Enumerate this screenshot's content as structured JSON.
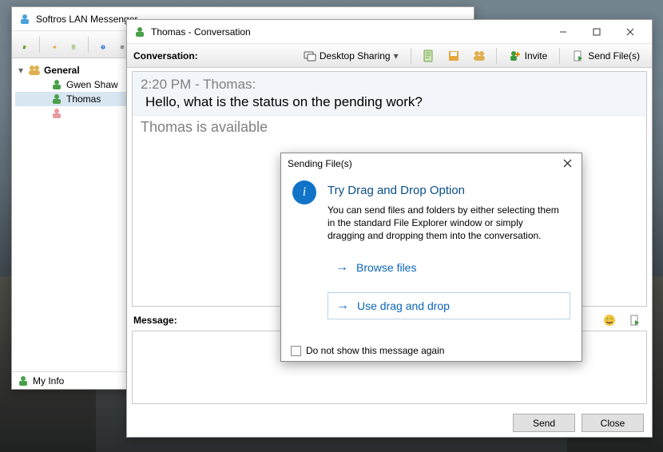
{
  "main_window": {
    "title": "Softros LAN Messenger",
    "tree": {
      "root_label": "General",
      "users": [
        {
          "name": "Gwen Shaw",
          "selected": false
        },
        {
          "name": "Thomas",
          "selected": true
        }
      ]
    },
    "statusbar": {
      "my_info": "My Info"
    }
  },
  "conversation_window": {
    "title": "Thomas - Conversation",
    "toolbar": {
      "section_label": "Conversation:",
      "desktop_sharing": "Desktop Sharing",
      "invite": "Invite",
      "send_files": "Send File(s)"
    },
    "message": {
      "header": "2:20 PM - Thomas:",
      "body": "Hello, what is the status on the pending work?"
    },
    "presence": "Thomas is available",
    "compose_label": "Message:",
    "buttons": {
      "send": "Send",
      "close": "Close"
    }
  },
  "dialog": {
    "title": "Sending File(s)",
    "heading": "Try Drag and Drop Option",
    "body": "You can send files and folders by either selecting them in the standard File Explorer window or simply dragging and dropping them into the conversation.",
    "option_browse": "Browse files",
    "option_dragdrop": "Use drag and drop",
    "checkbox_label": "Do not show this message again"
  }
}
